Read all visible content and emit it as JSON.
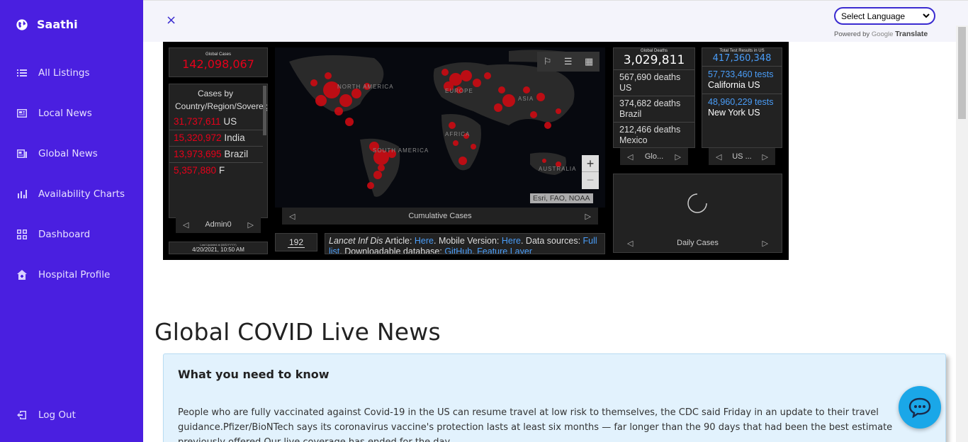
{
  "sidebar": {
    "brand": "Saathi",
    "items": [
      {
        "label": "All Listings",
        "icon": "list-icon"
      },
      {
        "label": "Local News",
        "icon": "newspaper-icon"
      },
      {
        "label": "Global News",
        "icon": "news-icon"
      },
      {
        "label": "Availability Charts",
        "icon": "bar-chart-icon"
      },
      {
        "label": "Dashboard",
        "icon": "dashboard-icon"
      },
      {
        "label": "Hospital Profile",
        "icon": "home-icon"
      }
    ],
    "logout": "Log Out"
  },
  "topbar": {
    "close": "×",
    "language_select": "Select Language",
    "powered_by": "Powered by",
    "google": "Google",
    "translate": "Translate"
  },
  "dashboard": {
    "global_cases_label": "Global Cases",
    "global_cases_value": "142,098,067",
    "cases_by_country_title": "Cases by Country/Region/Sovereignty",
    "countries": [
      {
        "value": "31,737,611",
        "name": "US"
      },
      {
        "value": "15,320,972",
        "name": "India"
      },
      {
        "value": "13,973,695",
        "name": "Brazil"
      },
      {
        "value": "5,357,880",
        "name": "F"
      }
    ],
    "admin_label": "Admin0",
    "last_updated_label": "Last Updated at (M/D/YYYY)",
    "last_updated_value": "4/20/2021, 10:50 AM",
    "map_regions": [
      "NORTH AMERICA",
      "EUROPE",
      "ASIA",
      "AFRICA",
      "SOUTH AMERICA",
      "AUSTRALIA"
    ],
    "map_attribution": "Esri, FAO, NOAA",
    "map_tab": "Cumulative Cases",
    "count_badge": "192",
    "article": {
      "journal": "Lancet Inf Dis",
      "article_text": " Article: ",
      "here1": "Here",
      "mobile_text": ". Mobile Version: ",
      "here2": "Here",
      "data_text": ". Data sources: ",
      "full_list": "Full list",
      "download_text": ". Downloadable database: ",
      "github": "GitHub",
      "feature_layer": "Feature Layer"
    },
    "global_deaths_label": "Global Deaths",
    "global_deaths_value": "3,029,811",
    "deaths": [
      {
        "value": "567,690",
        "unit": "deaths",
        "name": "US"
      },
      {
        "value": "374,682",
        "unit": "deaths",
        "name": "Brazil"
      },
      {
        "value": "212,466",
        "unit": "deaths",
        "name": "Mexico"
      }
    ],
    "deaths_tab": "Glo...",
    "tests_label": "Total Test Results in US",
    "tests_value": "417,360,348",
    "tests": [
      {
        "value": "57,733,460",
        "unit": "tests",
        "name": "California US"
      },
      {
        "value": "48,960,229",
        "unit": "tests",
        "name": "New York US"
      }
    ],
    "tests_tab": "US ...",
    "daily_tab": "Daily Cases"
  },
  "content": {
    "heading": "Global COVID Live News",
    "card_title": "What you need to know",
    "card_text": "People who are fully vaccinated against Covid-19 in the US can resume travel at low risk to themselves, the CDC said Friday in an update to their travel guidance.Pfizer/BioNTech says its coronavirus vaccine's protection lasts at least six months — far longer than the 90 days that had been the best estimate previously offered.Our live coverage has ended for the day."
  },
  "colors": {
    "sidebar": "#4a1fe0",
    "accent": "#3a2bd0",
    "card_bg": "#e2f2fd",
    "chat": "#1aa7e8",
    "dash_red": "#e6001a",
    "dash_blue": "#4a9df8"
  }
}
